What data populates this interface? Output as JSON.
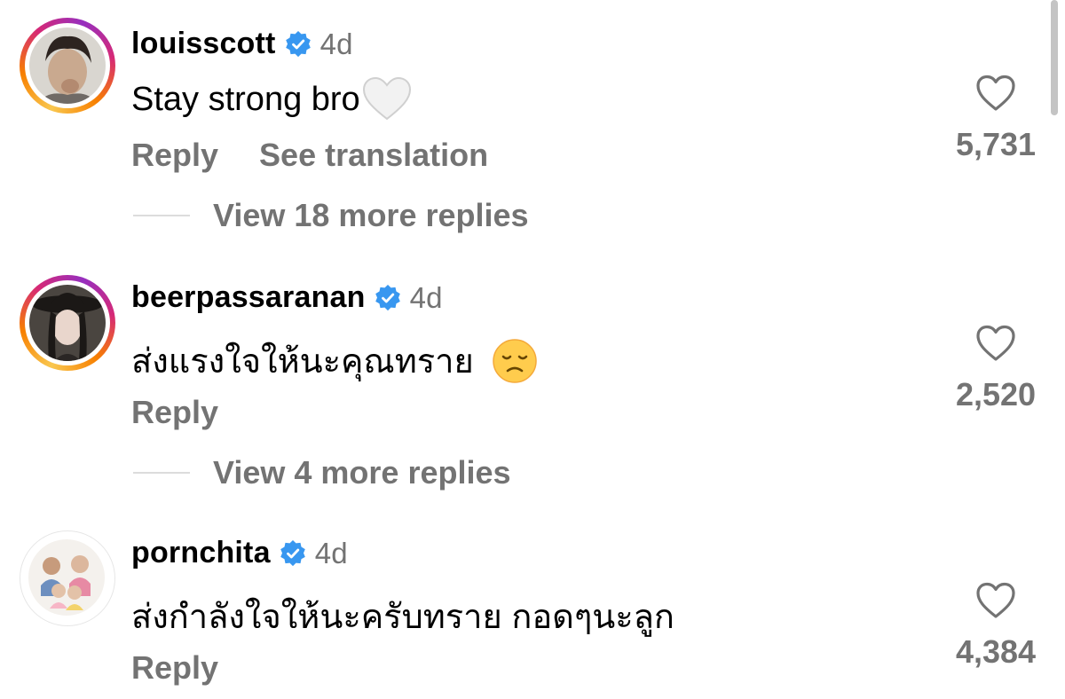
{
  "comments": [
    {
      "username": "louisscott",
      "time": "4d",
      "text": "Stay strong bro",
      "reply_label": "Reply",
      "translate_label": "See translation",
      "view_replies": "View 18 more replies",
      "likes": "5,731"
    },
    {
      "username": "beerpassaranan",
      "time": "4d",
      "text": "ส่งแรงใจให้นะคุณทราย",
      "reply_label": "Reply",
      "view_replies": "View 4 more replies",
      "likes": "2,520"
    },
    {
      "username": "pornchita",
      "time": "4d",
      "text": "ส่งกำลังใจให้นะครับทราย กอดๆนะลูก",
      "reply_label": "Reply",
      "likes": "4,384"
    }
  ],
  "icons": {
    "verified": "verified-badge-icon",
    "like": "heart-outline-icon",
    "emoji_1": "white-heart-emoji",
    "emoji_2": "disappointed-face-emoji"
  },
  "colors": {
    "secondary_text": "#737373",
    "verified_blue": "#3897f0"
  }
}
